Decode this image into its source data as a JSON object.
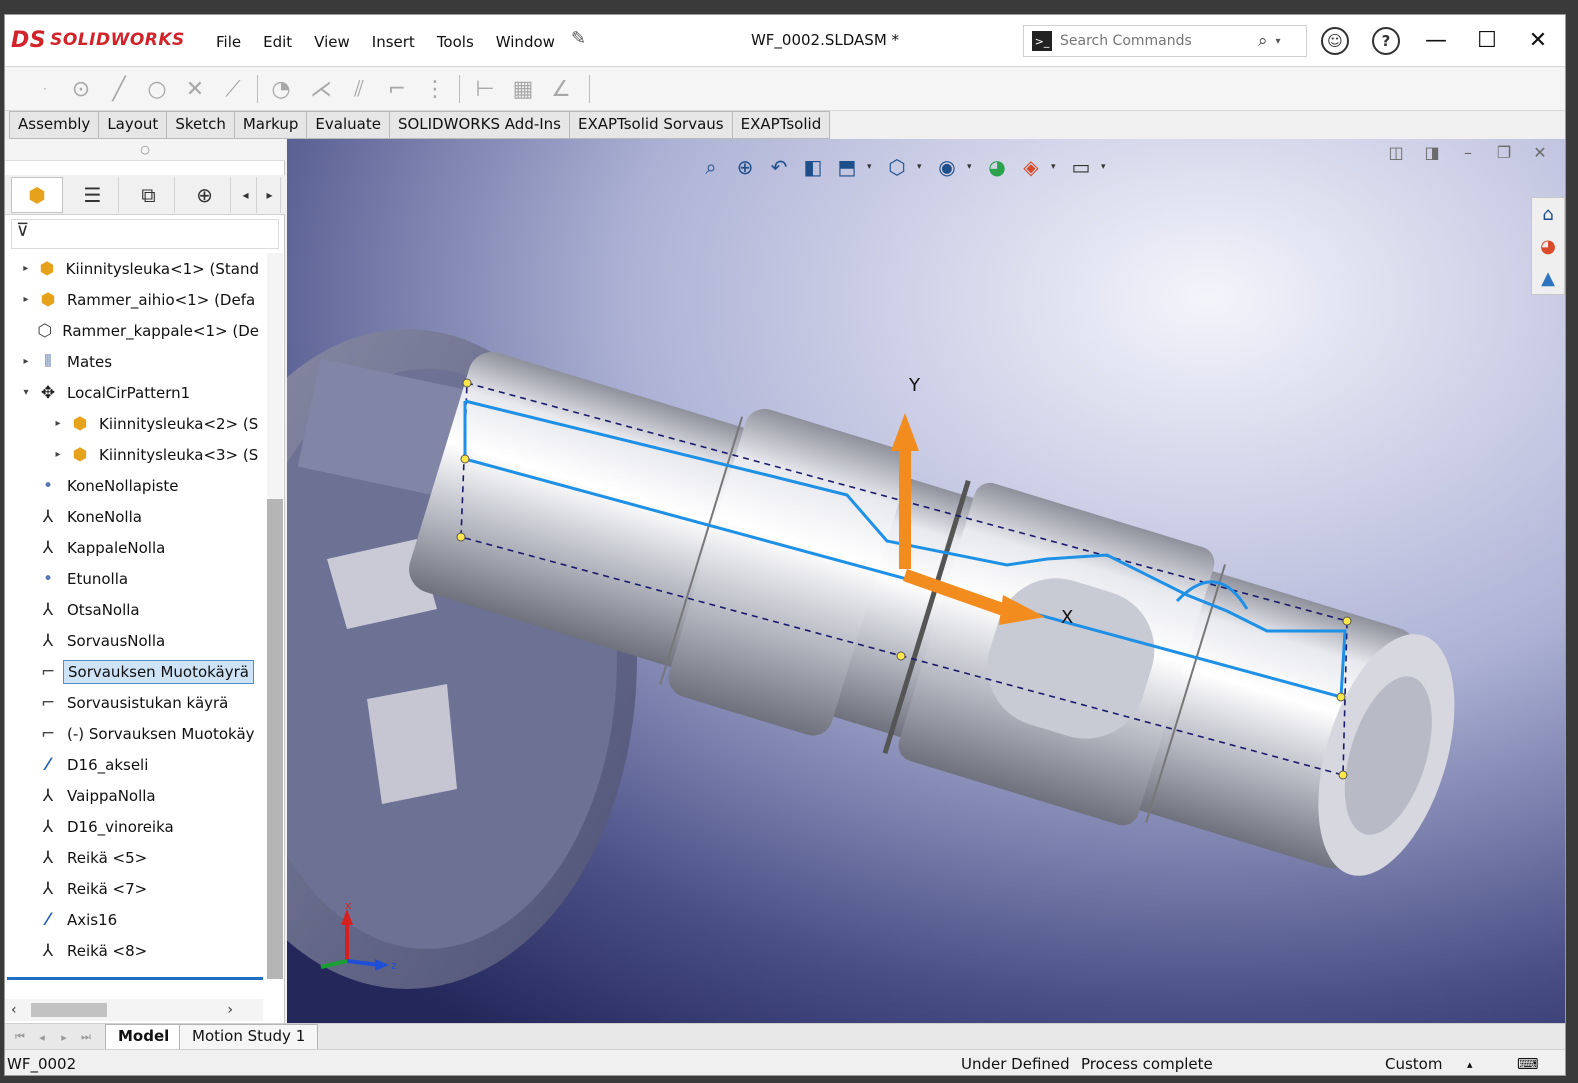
{
  "app": {
    "brand": "SOLIDWORKS",
    "brand_mark": "DS",
    "document_title": "WF_0002.SLDASM *",
    "menus": [
      "File",
      "Edit",
      "View",
      "Insert",
      "Tools",
      "Window"
    ],
    "search_placeholder": "Search Commands",
    "brand_color": "#d2232a"
  },
  "command_tabs": [
    "Assembly",
    "Layout",
    "Sketch",
    "Markup",
    "Evaluate",
    "SOLIDWORKS Add-Ins",
    "EXAPTsolid Sorvaus",
    "EXAPTsolid"
  ],
  "feature_tree": [
    {
      "label": "Kiinnitysleuka<1> (Stand",
      "icon": "part-icon",
      "expand": "▸",
      "indent": 0
    },
    {
      "label": "Rammer_aihio<1> (Defa",
      "icon": "part-icon",
      "expand": "▸",
      "indent": 0
    },
    {
      "label": "Rammer_kappale<1> (De",
      "icon": "part-outline-icon",
      "expand": "",
      "indent": 0
    },
    {
      "label": "Mates",
      "icon": "mates-icon",
      "expand": "▸",
      "indent": 0
    },
    {
      "label": "LocalCirPattern1",
      "icon": "pattern-icon",
      "expand": "▾",
      "indent": 0
    },
    {
      "label": "Kiinnitysleuka<2> (S",
      "icon": "part-icon",
      "expand": "▸",
      "indent": 1
    },
    {
      "label": "Kiinnitysleuka<3> (S",
      "icon": "part-icon",
      "expand": "▸",
      "indent": 1
    },
    {
      "label": "KoneNollapiste",
      "icon": "point-icon",
      "expand": "",
      "indent": 0
    },
    {
      "label": "KoneNolla",
      "icon": "coordinate-system-icon",
      "expand": "",
      "indent": 0
    },
    {
      "label": "KappaleNolla",
      "icon": "coordinate-system-icon",
      "expand": "",
      "indent": 0
    },
    {
      "label": "Etunolla",
      "icon": "point-icon",
      "expand": "",
      "indent": 0
    },
    {
      "label": "OtsaNolla",
      "icon": "coordinate-system-icon",
      "expand": "",
      "indent": 0
    },
    {
      "label": "SorvausNolla",
      "icon": "coordinate-system-icon",
      "expand": "",
      "indent": 0
    },
    {
      "label": "Sorvauksen Muotokäyrä",
      "icon": "sketch-icon",
      "expand": "",
      "indent": 0,
      "selected": true
    },
    {
      "label": "Sorvausistukan käyrä",
      "icon": "sketch-icon",
      "expand": "",
      "indent": 0
    },
    {
      "label": "(-) Sorvauksen Muotokäy",
      "icon": "sketch-icon",
      "expand": "",
      "indent": 0
    },
    {
      "label": "D16_akseli",
      "icon": "axis-icon",
      "expand": "",
      "indent": 0
    },
    {
      "label": "VaippaNolla",
      "icon": "coordinate-system-icon",
      "expand": "",
      "indent": 0
    },
    {
      "label": "D16_vinoreika",
      "icon": "coordinate-system-icon",
      "expand": "",
      "indent": 0
    },
    {
      "label": "Reikä <5>",
      "icon": "coordinate-system-icon",
      "expand": "",
      "indent": 0
    },
    {
      "label": "Reikä <7>",
      "icon": "coordinate-system-icon",
      "expand": "",
      "indent": 0
    },
    {
      "label": "Axis16",
      "icon": "axis-icon",
      "expand": "",
      "indent": 0
    },
    {
      "label": "Reikä <8>",
      "icon": "coordinate-system-icon",
      "expand": "",
      "indent": 0
    }
  ],
  "viewport": {
    "axis_labels": {
      "x": "X",
      "y": "Y"
    },
    "triad_labels": {
      "x": "x",
      "z": "z"
    },
    "sketch_color": "#1e90e6",
    "arrow_color": "#f28c1e"
  },
  "bottom_tabs": [
    "Model",
    "Motion Study 1"
  ],
  "status": {
    "left": "WF_0002",
    "state": "Under Defined",
    "process": "Process complete",
    "units": "Custom"
  }
}
